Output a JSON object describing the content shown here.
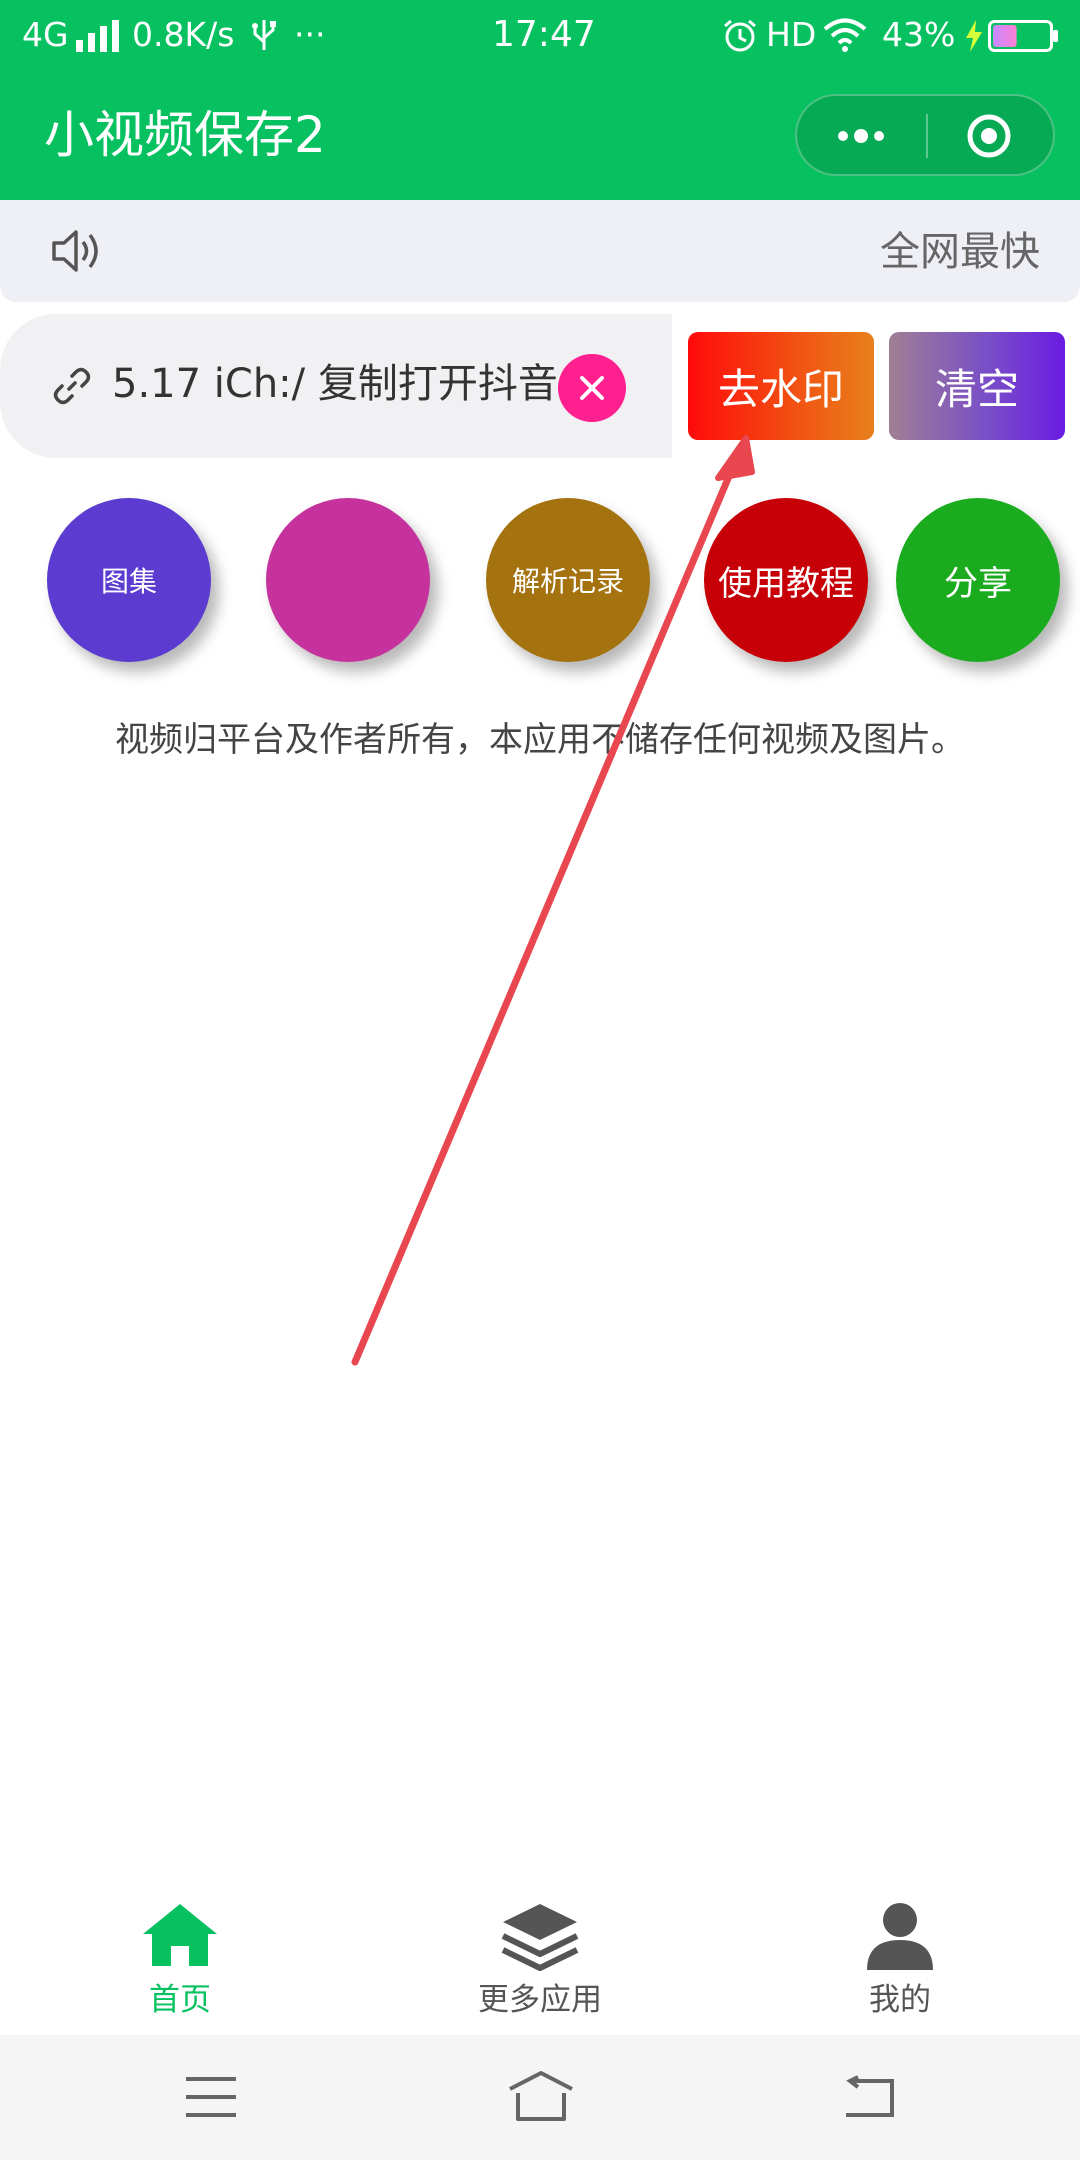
{
  "status_bar": {
    "network_type": "4G",
    "net_speed": "0.8K/s",
    "more": "···",
    "time": "17:47",
    "hd": "HD",
    "battery_percent": "43%",
    "battery_level": 0.43,
    "icons": [
      "signal-icon",
      "usb-icon",
      "alarm-icon",
      "wifi-icon",
      "charging-icon",
      "battery-icon"
    ]
  },
  "title_bar": {
    "title": "小视频保存2",
    "capsule_icons": [
      "more-dots-icon",
      "close-target-icon"
    ]
  },
  "notice_bar": {
    "icon": "speaker-icon",
    "text": "全网最快"
  },
  "link_input": {
    "icon": "link-icon",
    "value": "5.17 iCh:/ 复制打开抖音",
    "clear_icon": "close-icon"
  },
  "buttons": {
    "remove_watermark": "去水印",
    "clear": "清空"
  },
  "circle_buttons": [
    {
      "label": "图集",
      "color": "#5b3bd0"
    },
    {
      "label": "",
      "color": "#c6329d"
    },
    {
      "label": "解析记录",
      "color": "#a4720f"
    },
    {
      "label": "使用教程",
      "color": "#c60006"
    },
    {
      "label": "分享",
      "color": "#1aab1f"
    }
  ],
  "disclaimer": "视频归平台及作者所有，本应用不储存任何视频及图片。",
  "tab_bar": {
    "items": [
      {
        "label": "首页",
        "icon": "home-icon",
        "active": true
      },
      {
        "label": "更多应用",
        "icon": "layers-icon",
        "active": false
      },
      {
        "label": "我的",
        "icon": "user-icon",
        "active": false
      }
    ]
  },
  "nav_bar": {
    "icons": [
      "menu-icon",
      "home-outline-icon",
      "back-icon"
    ]
  },
  "colors": {
    "brand_green": "#07c160",
    "annotation_red": "#e8474f",
    "tab_active": "#07c160",
    "tab_inactive": "#555555"
  }
}
